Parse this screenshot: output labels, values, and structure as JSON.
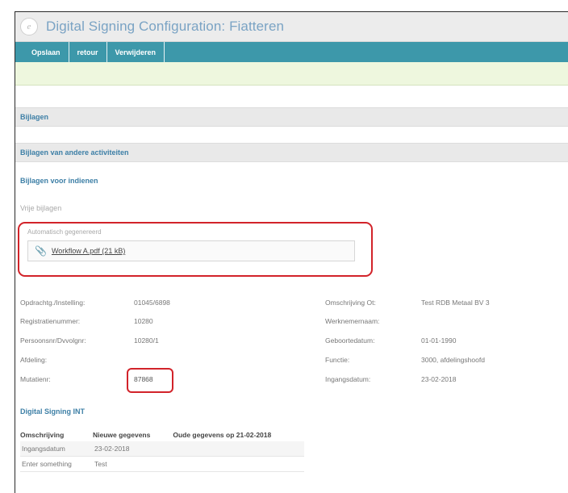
{
  "window": {
    "title": "Digital Signing Configuration: Fiatteren"
  },
  "toolbar": {
    "buttons": [
      "Opslaan",
      "retour",
      "Verwijderen"
    ]
  },
  "sections": {
    "bijlagen": "Bijlagen",
    "bijlagen_andere": "Bijlagen van andere activiteiten"
  },
  "links": {
    "bijlagen_indienen": "Bijlagen voor indienen",
    "vrije_bijlagen": "Vrije bijlagen"
  },
  "auto": {
    "label": "Automatisch gegenereerd",
    "file": "Workflow A.pdf (21 kB)"
  },
  "fields_left": [
    {
      "label": "Opdrachtg./Instelling:",
      "value": "01045/6898"
    },
    {
      "label": "Registratienummer:",
      "value": "10280"
    },
    {
      "label": "Persoonsnr/Dvvolgnr:",
      "value": "10280/1"
    },
    {
      "label": "Afdeling:",
      "value": ""
    },
    {
      "label": "Mutatienr:",
      "value": "87868"
    }
  ],
  "fields_right": [
    {
      "label": "Omschrijving Ot:",
      "value": "Test RDB Metaal BV 3"
    },
    {
      "label": "Werknemernaam:",
      "value": ""
    },
    {
      "label": "Geboortedatum:",
      "value": "01-01-1990"
    },
    {
      "label": "Functie:",
      "value": "3000, afdelingshoofd"
    },
    {
      "label": "Ingangsdatum:",
      "value": "23-02-2018"
    }
  ],
  "digital_signing": {
    "title": "Digital Signing INT",
    "headers": [
      "Omschrijving",
      "Nieuwe gegevens",
      "Oude gegevens op 21-02-2018"
    ],
    "rows": [
      [
        "Ingangsdatum",
        "23-02-2018",
        ""
      ],
      [
        "Enter something",
        "Test",
        ""
      ]
    ]
  },
  "colors": {
    "toolbar": "#3d98aa",
    "highlight": "#d2232a",
    "link": "#3d7fa6",
    "notice": "#eef7de"
  }
}
